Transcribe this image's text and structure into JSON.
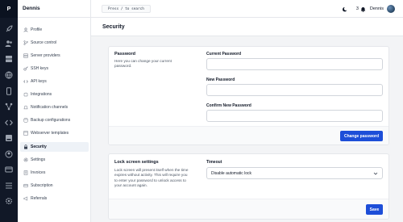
{
  "rail": {
    "logo": "P"
  },
  "sidebar": {
    "user": "Dennis",
    "items": [
      {
        "label": "Profile",
        "icon": "user-icon"
      },
      {
        "label": "Source control",
        "icon": "branch-icon"
      },
      {
        "label": "Server providers",
        "icon": "server-icon"
      },
      {
        "label": "SSH keys",
        "icon": "key-icon"
      },
      {
        "label": "API keys",
        "icon": "code-icon"
      },
      {
        "label": "Integrations",
        "icon": "puzzle-icon"
      },
      {
        "label": "Notification channels",
        "icon": "bell-icon"
      },
      {
        "label": "Backup configurations",
        "icon": "database-icon"
      },
      {
        "label": "Webserver templates",
        "icon": "template-icon"
      },
      {
        "label": "Security",
        "icon": "lock-icon",
        "active": true
      },
      {
        "label": "Settings",
        "icon": "gear-icon"
      },
      {
        "label": "Invoices",
        "icon": "invoice-icon"
      },
      {
        "label": "Subscription",
        "icon": "card-icon"
      },
      {
        "label": "Referrals",
        "icon": "megaphone-icon"
      }
    ]
  },
  "topbar": {
    "search_label": "Press / to search",
    "notification_count": "3",
    "user_name": "Dennis"
  },
  "page": {
    "title": "Security"
  },
  "password": {
    "title": "Password",
    "description": "Here you can change your current password.",
    "current_label": "Current Password",
    "new_label": "New Password",
    "confirm_label": "Confirm New Password",
    "submit_label": "Change password"
  },
  "lock": {
    "title": "Lock screen settings",
    "description": "Lock screen will present itself when the time expires without activity. This will require you to enter your password to unlock access to your account again.",
    "timeout_label": "Timeout",
    "timeout_value": "Disable automatic lock",
    "save_label": "Save"
  },
  "colors": {
    "accent": "#1d4ed8",
    "rail": "#111827",
    "background": "#f3f4f6"
  }
}
